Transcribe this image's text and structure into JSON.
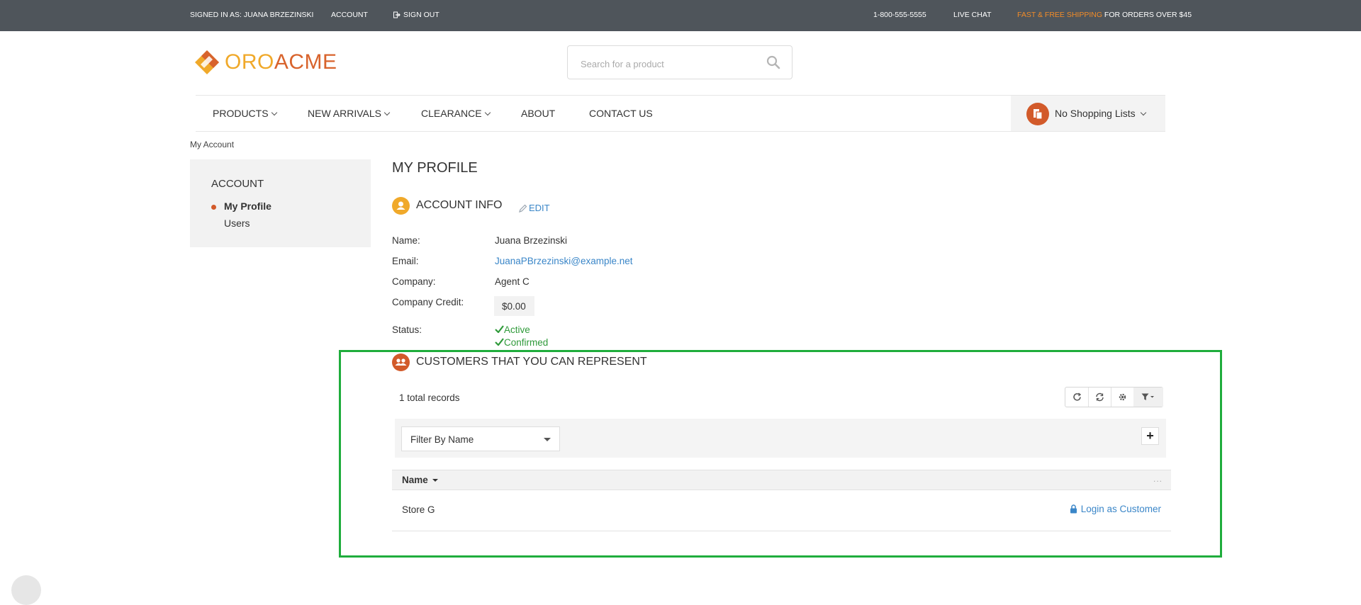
{
  "topbar": {
    "signed_in": "SIGNED IN AS: JUANA BRZEZINSKI",
    "account": "ACCOUNT",
    "sign_out": "SIGN OUT",
    "phone": "1-800-555-5555",
    "live_chat": "LIVE CHAT",
    "shipping_accent": "FAST & FREE SHIPPING",
    "shipping_rest": " FOR ORDERS OVER $45"
  },
  "logo": {
    "part1": "ORO",
    "part2": "ACME"
  },
  "search": {
    "placeholder": "Search for a product"
  },
  "nav": {
    "items": [
      "PRODUCTS",
      "NEW ARRIVALS",
      "CLEARANCE",
      "ABOUT",
      "CONTACT US"
    ],
    "shopping_lists": "No Shopping Lists"
  },
  "breadcrumb": "My Account",
  "sidebar": {
    "title": "ACCOUNT",
    "items": [
      "My Profile",
      "Users"
    ]
  },
  "main": {
    "title": "MY PROFILE",
    "account_info": {
      "title": "ACCOUNT INFO",
      "edit": "EDIT",
      "labels": {
        "name": "Name:",
        "email": "Email:",
        "company": "Company:",
        "credit": "Company Credit:",
        "status": "Status:"
      },
      "values": {
        "name": "Juana Brzezinski",
        "email": "JuanaPBrzezinski@example.net",
        "company": "Agent C",
        "credit": "$0.00",
        "status_1": "Active",
        "status_2": "Confirmed"
      }
    },
    "customers": {
      "title": "CUSTOMERS THAT YOU CAN REPRESENT",
      "records": "1 total records",
      "filter_select": "Filter By Name",
      "add_filter": "+",
      "columns": {
        "name": "Name",
        "actions": "..."
      },
      "rows": [
        {
          "name": "Store G",
          "action": "Login as Customer"
        }
      ]
    }
  },
  "colors": {
    "topbar": "#4f555b",
    "accent_orange": "#f28c28",
    "brand_red": "#d25a2a",
    "link_blue": "#3a86c8",
    "status_green": "#2f9a3a",
    "highlight_green": "#1fad3c"
  },
  "icons": {
    "sign_out": "sign-out-icon",
    "search": "search-icon",
    "shopping_list": "shopping-list-icon",
    "account_info": "user-icon",
    "customers": "customers-icon",
    "edit": "pencil-icon",
    "check": "check-icon",
    "refresh": "refresh-icon",
    "reset": "reset-icon",
    "settings": "gear-icon",
    "filter": "filter-icon",
    "login": "lock-icon"
  }
}
